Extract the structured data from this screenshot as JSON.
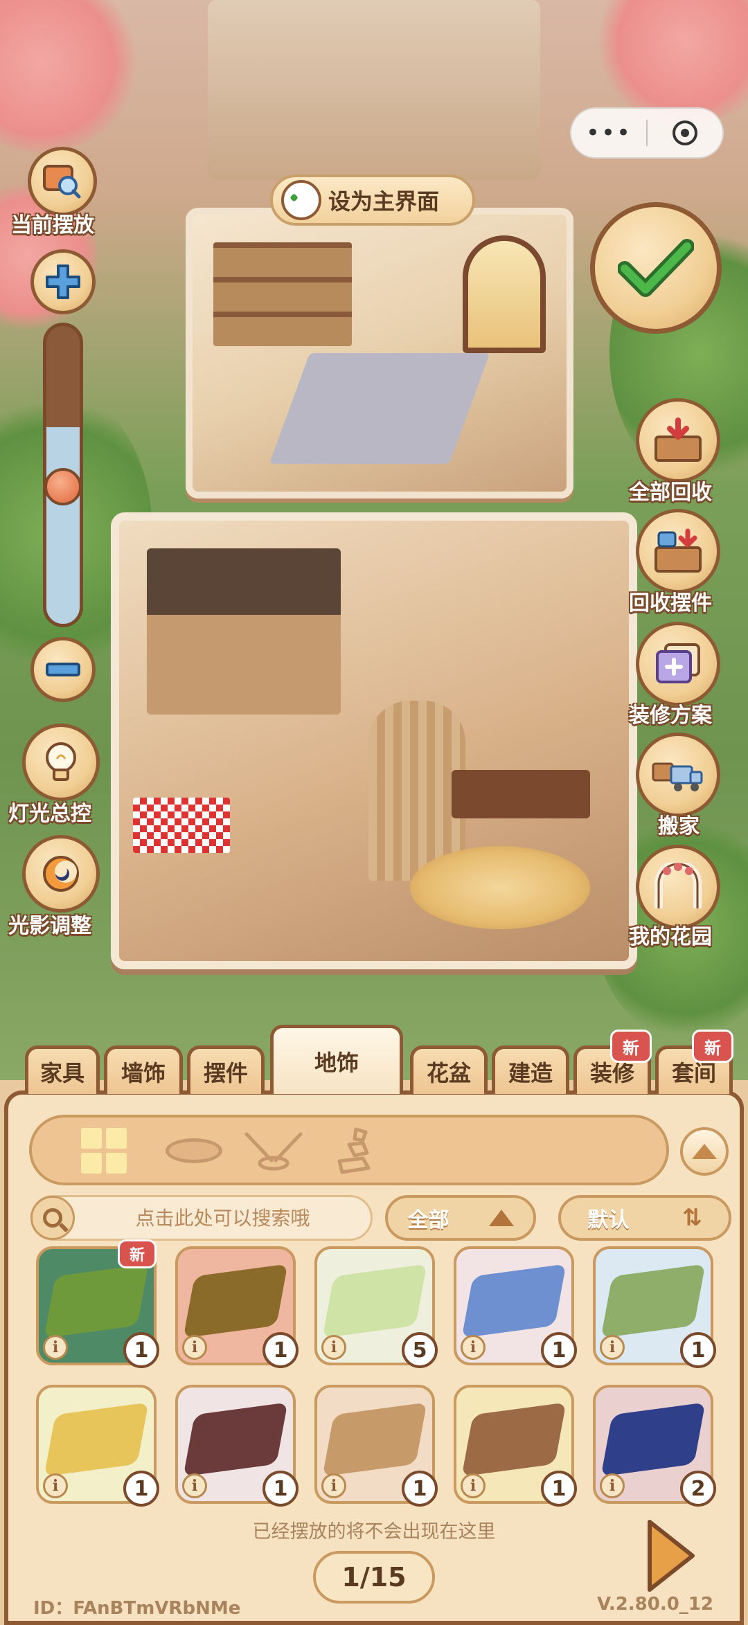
{
  "hud": {
    "set_main_label": "设为主界面",
    "current_placement_label": "当前摆放",
    "lighting_control_label": "灯光总控",
    "light_shadow_label": "光影调整",
    "zoom_level": 0.45
  },
  "side_actions": [
    {
      "label": "全部回收",
      "icon": "recycle-all-icon"
    },
    {
      "label": "回收摆件",
      "icon": "recycle-ornament-icon"
    },
    {
      "label": "装修方案",
      "icon": "decor-plan-icon"
    },
    {
      "label": "搬家",
      "icon": "moving-truck-icon"
    },
    {
      "label": "我的花园",
      "icon": "garden-arch-icon"
    }
  ],
  "tabs": [
    {
      "label": "家具",
      "active": false,
      "new": false
    },
    {
      "label": "墙饰",
      "active": false,
      "new": false
    },
    {
      "label": "摆件",
      "active": false,
      "new": false
    },
    {
      "label": "地饰",
      "active": true,
      "new": false
    },
    {
      "label": "花盆",
      "active": false,
      "new": false
    },
    {
      "label": "建造",
      "active": false,
      "new": false
    },
    {
      "label": "装修",
      "active": false,
      "new": true
    },
    {
      "label": "套间",
      "active": false,
      "new": true
    }
  ],
  "new_badge_text": "新",
  "filter_icons": [
    "grid-all-icon",
    "rug-oval-icon",
    "hanging-lamp-icon",
    "stones-icon"
  ],
  "search": {
    "placeholder": "点击此处可以搜索哦"
  },
  "filter_dropdown": {
    "label": "全部"
  },
  "sort_dropdown": {
    "label": "默认"
  },
  "items": [
    {
      "name": "grass-patch-rug",
      "count": "1",
      "new": true,
      "color": "#6f9a3c",
      "bg": "#4f8a66"
    },
    {
      "name": "autumn-leaf-runner",
      "count": "1",
      "new": false,
      "color": "#8b6b2a",
      "bg": "#f0b7a0"
    },
    {
      "name": "daisy-rug",
      "count": "5",
      "new": false,
      "color": "#cfe3a6",
      "bg": "#eef0dd"
    },
    {
      "name": "blue-runner",
      "count": "1",
      "new": false,
      "color": "#6e8fd0",
      "bg": "#f2e4e4"
    },
    {
      "name": "moss-stone-rug",
      "count": "1",
      "new": false,
      "color": "#8fae6a",
      "bg": "#dde9f2"
    },
    {
      "name": "leaf-yellow-rug",
      "count": "1",
      "new": false,
      "color": "#e8c55a",
      "bg": "#f3efc9"
    },
    {
      "name": "dark-leaf-rug",
      "count": "1",
      "new": false,
      "color": "#6b3a3a",
      "bg": "#f1e4e4"
    },
    {
      "name": "boho-diamond-rug",
      "count": "1",
      "new": false,
      "color": "#c79a6a",
      "bg": "#f2dcc6"
    },
    {
      "name": "brown-square-rug",
      "count": "1",
      "new": false,
      "color": "#9c6a44",
      "bg": "#f6e7b8"
    },
    {
      "name": "navy-runner",
      "count": "2",
      "new": false,
      "color": "#2f3f8a",
      "bg": "#ead0cf"
    }
  ],
  "hint": "已经摆放的将不会出现在这里",
  "pager": "1/15",
  "footer": {
    "id": "ID：FAnBTmVRbNMe",
    "version": "V.2.80.0_12"
  }
}
